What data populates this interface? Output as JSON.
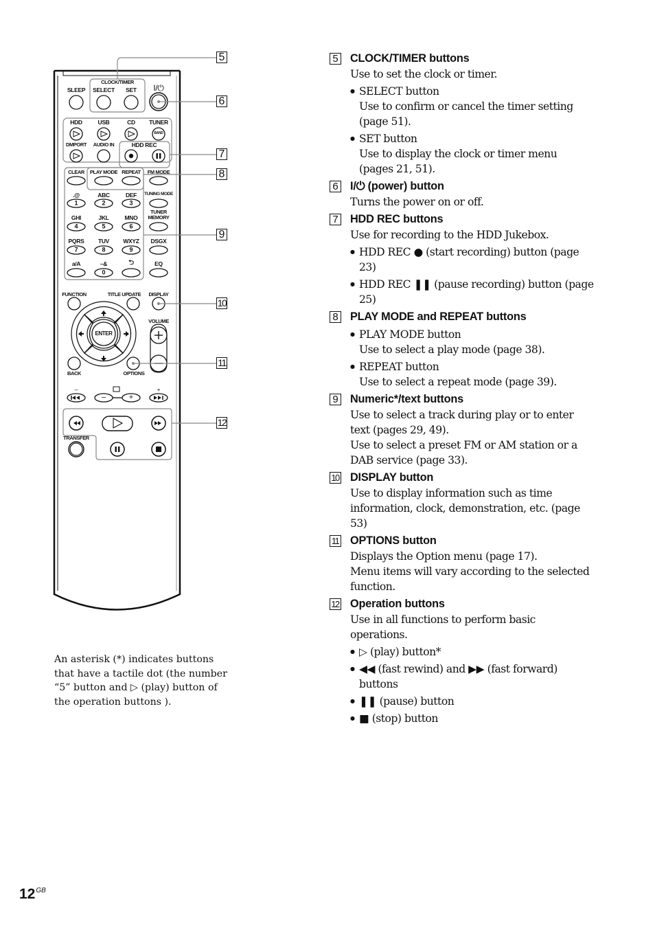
{
  "remote": {
    "labels": {
      "clock_timer": "CLOCK/TIMER",
      "sleep": "SLEEP",
      "select": "SELECT",
      "set": "SET",
      "power": "I/⏻",
      "hdd": "HDD",
      "usb": "USB",
      "cd": "CD",
      "tuner": "TUNER",
      "band": "BAND",
      "dmport": "DMPORT",
      "audio_in": "AUDIO IN",
      "hdd_rec": "HDD REC",
      "clear": "CLEAR",
      "play_mode": "PLAY MODE",
      "repeat": "REPEAT",
      "fm_mode": "FM MODE",
      "tuning_mode": "TUNING MODE",
      "tuner_memory_1": "TUNER",
      "tuner_memory_2": "MEMORY",
      "dsgx": "DSGX",
      "eq": "EQ",
      "function": "FUNCTION",
      "title_update": "TITLE UPDATE",
      "display": "DISPLAY",
      "volume": "VOLUME",
      "enter": "ENTER",
      "back": "BACK",
      "options": "OPTIONS",
      "transfer": "TRANSFER",
      "prev_minus": "–",
      "next_plus": "+",
      "vol_plus": "+",
      "vol_minus": "–",
      "folder_minus": "–",
      "folder_plus": "+"
    },
    "keypad": [
      {
        "letters": ".@",
        "digit": "1"
      },
      {
        "letters": "ABC",
        "digit": "2"
      },
      {
        "letters": "DEF",
        "digit": "3"
      },
      {
        "letters": "GHI",
        "digit": "4"
      },
      {
        "letters": "JKL",
        "digit": "5"
      },
      {
        "letters": "MNO",
        "digit": "6"
      },
      {
        "letters": "PQRS",
        "digit": "7"
      },
      {
        "letters": "TUV",
        "digit": "8"
      },
      {
        "letters": "WXYZ",
        "digit": "9"
      },
      {
        "letters": "a/A",
        "digit": ""
      },
      {
        "letters": "–&",
        "digit": "0"
      },
      {
        "letters": "⮌",
        "digit": ""
      }
    ],
    "callouts": [
      "5",
      "6",
      "7",
      "8",
      "9",
      "10",
      "11",
      "12"
    ]
  },
  "note": "An asterisk (*) indicates buttons that have a tactile dot (the number “5” button and ▷ (play) button of the operation buttons ).",
  "sections": [
    {
      "num": "5",
      "title": "CLOCK/TIMER buttons",
      "intro": "Use to set the clock or timer.",
      "bullets": [
        {
          "head": "SELECT button",
          "body": "Use to confirm or cancel the timer setting (page 51)."
        },
        {
          "head": "SET button",
          "body": "Use to display the clock or timer menu (pages 21, 51)."
        }
      ]
    },
    {
      "num": "6",
      "title": "I/⏻ (power) button",
      "intro": "Turns the power on or off."
    },
    {
      "num": "7",
      "title": "HDD REC buttons",
      "intro": "Use for recording to the HDD Jukebox.",
      "bullets": [
        {
          "head": "HDD REC ● (start recording) button (page 23)"
        },
        {
          "head": "HDD REC ❚❚ (pause recording) button (page 25)"
        }
      ]
    },
    {
      "num": "8",
      "title": "PLAY MODE and REPEAT buttons",
      "bullets": [
        {
          "head": "PLAY MODE button",
          "body": "Use to select a play mode (page 38)."
        },
        {
          "head": "REPEAT button",
          "body": "Use to select a repeat mode (page 39)."
        }
      ]
    },
    {
      "num": "9",
      "title": "Numeric*/text buttons",
      "intro": "Use to select a track during play or to enter text (pages 29, 49).",
      "intro2": "Use to select a preset FM or AM station or a DAB service (page 33)."
    },
    {
      "num": "10",
      "title": "DISPLAY button",
      "intro": "Use to display information such as time information, clock, demonstration, etc. (page 53)"
    },
    {
      "num": "11",
      "title": "OPTIONS button",
      "intro": "Displays the Option menu (page 17).",
      "intro2": "Menu items will vary according to the selected function."
    },
    {
      "num": "12",
      "title": "Operation buttons",
      "intro": "Use in all functions to perform basic operations.",
      "bullets": [
        {
          "head": "▷ (play) button*"
        },
        {
          "head": "◀◀ (fast rewind)  and ▶▶ (fast forward) buttons"
        },
        {
          "head": "❚❚ (pause) button"
        },
        {
          "head": "■ (stop) button"
        }
      ]
    }
  ],
  "footer": {
    "page_number": "12",
    "page_suffix": "GB"
  }
}
